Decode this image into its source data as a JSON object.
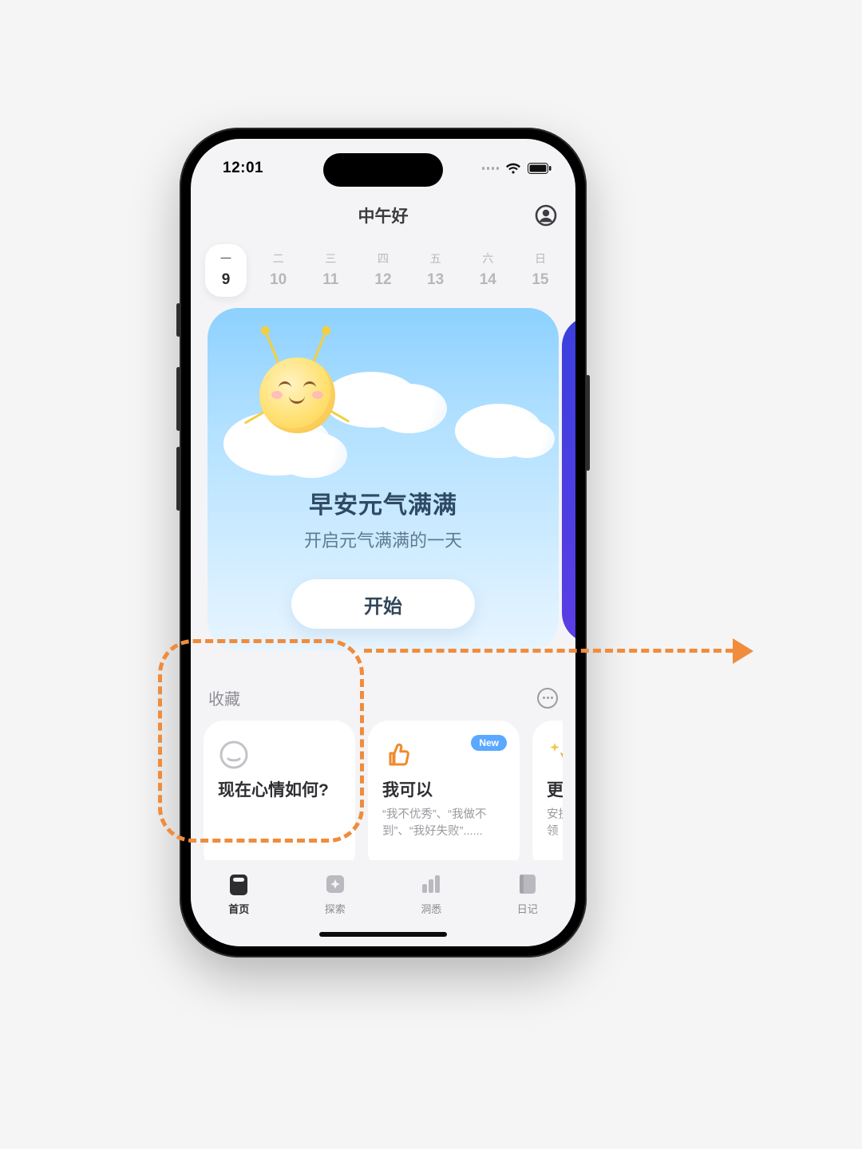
{
  "status": {
    "time": "12:01"
  },
  "header": {
    "greeting": "中午好"
  },
  "calendar": {
    "days": [
      {
        "weekday": "一",
        "date": "9",
        "selected": true
      },
      {
        "weekday": "二",
        "date": "10",
        "selected": false
      },
      {
        "weekday": "三",
        "date": "11",
        "selected": false
      },
      {
        "weekday": "四",
        "date": "12",
        "selected": false
      },
      {
        "weekday": "五",
        "date": "13",
        "selected": false
      },
      {
        "weekday": "六",
        "date": "14",
        "selected": false
      },
      {
        "weekday": "日",
        "date": "15",
        "selected": false
      }
    ]
  },
  "hero": {
    "title": "早安元气满满",
    "subtitle": "开启元气满满的一天",
    "cta": "开始"
  },
  "favorites": {
    "title": "收藏",
    "cards": [
      {
        "heading": "现在心情如何?",
        "desc": "",
        "badge": "",
        "icon": "mood-circle"
      },
      {
        "heading": "我可以",
        "desc": "“我不优秀”、“我做不到”、“我好失败”......",
        "badge": "New",
        "icon": "thumbs-up"
      },
      {
        "heading": "更专",
        "desc": "安抚自\n动引领",
        "badge": "",
        "icon": "sparkle-cursor"
      }
    ]
  },
  "tabs": {
    "items": [
      {
        "label": "首页",
        "icon": "home",
        "active": true
      },
      {
        "label": "探索",
        "icon": "explore",
        "active": false
      },
      {
        "label": "洞悉",
        "icon": "insight",
        "active": false
      },
      {
        "label": "日记",
        "icon": "diary",
        "active": false
      }
    ]
  }
}
